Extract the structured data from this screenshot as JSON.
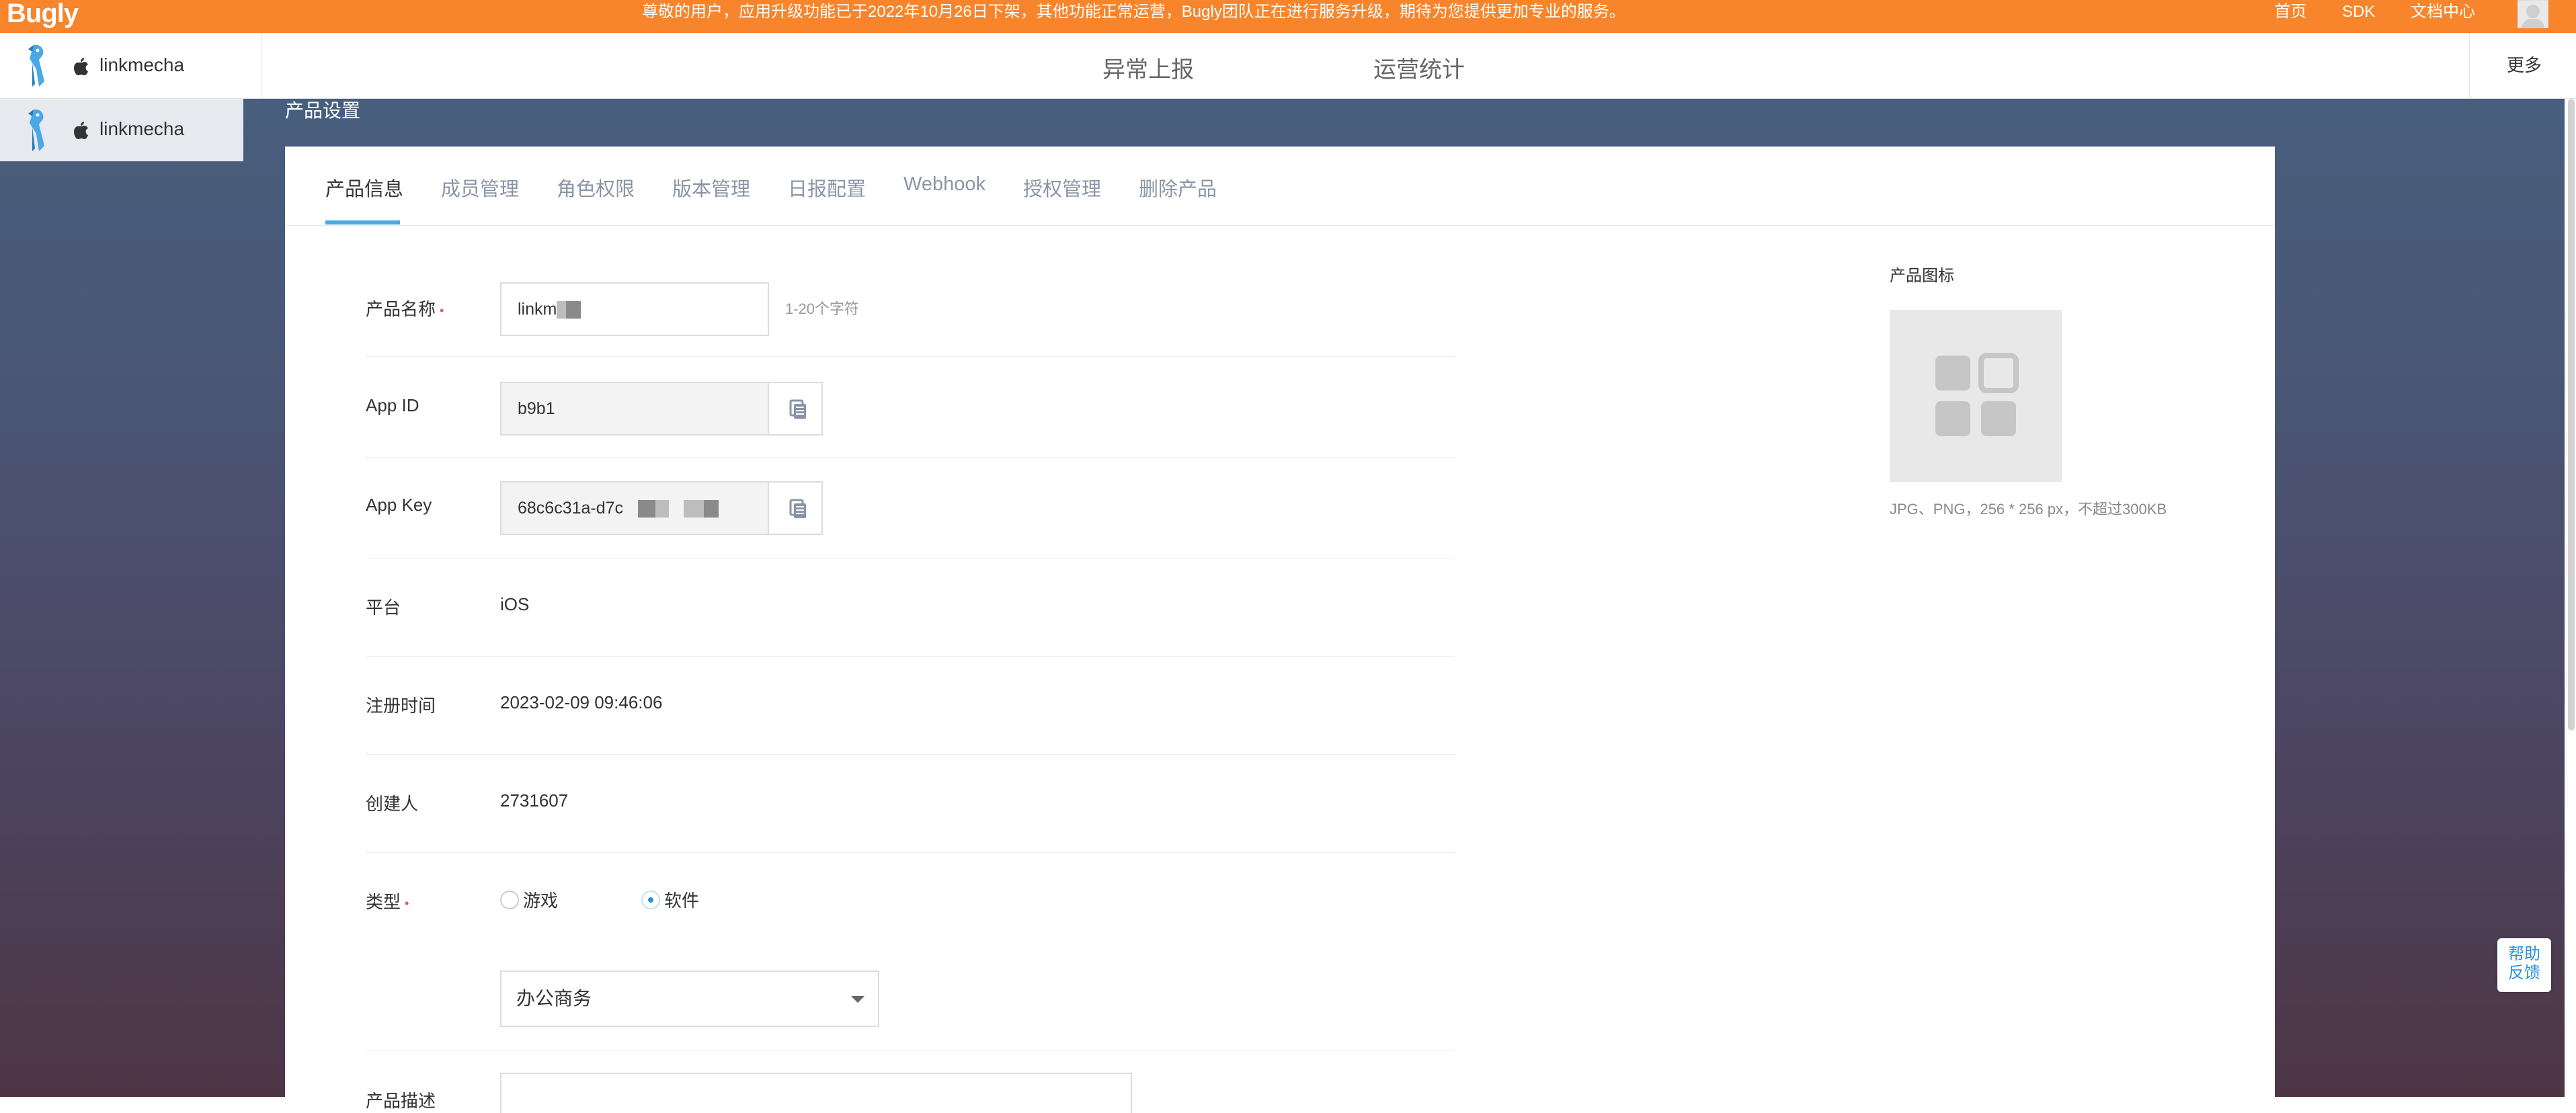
{
  "colors": {
    "brand": "#f8842b",
    "accent": "#4aa8e6",
    "required": "#e85a5a",
    "help": "#2f8fdc"
  },
  "topbar": {
    "logo": "Bugly",
    "notice": "尊敬的用户，应用升级功能已于2022年10月26日下架，其他功能正常运营，Bugly团队正在进行服务升级，期待为您提供更加专业的服务。",
    "links": [
      "首页",
      "SDK",
      "文档中心"
    ]
  },
  "navbar": {
    "app_name": "linkmecha",
    "menu": [
      "异常上报",
      "运营统计"
    ],
    "more": "更多"
  },
  "sidebar": {
    "app_name": "linkmecha"
  },
  "page_title": "产品设置",
  "tabs": [
    "产品信息",
    "成员管理",
    "角色权限",
    "版本管理",
    "日报配置",
    "Webhook",
    "授权管理",
    "删除产品"
  ],
  "form": {
    "name_label": "产品名称",
    "name_value": "linkm",
    "name_hint": "1-20个字符",
    "appid_label": "App ID",
    "appid_value": "b9b1",
    "appkey_label": "App Key",
    "appkey_value": "68c6c31a-d7c",
    "platform_label": "平台",
    "platform_value": "iOS",
    "regtime_label": "注册时间",
    "regtime_value": "2023-02-09 09:46:06",
    "creator_label": "创建人",
    "creator_value": "2731607",
    "type_label": "类型",
    "type_option_game": "游戏",
    "type_option_software": "软件",
    "category_value": "办公商务",
    "desc_label": "产品描述"
  },
  "icon": {
    "title": "产品图标",
    "note": "JPG、PNG，256 * 256 px，不超过300KB"
  },
  "help": {
    "line1": "帮助",
    "line2": "反馈"
  }
}
